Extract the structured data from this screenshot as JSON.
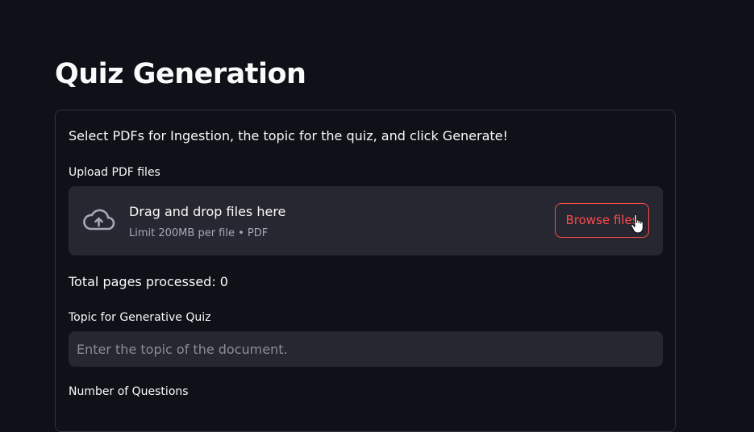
{
  "page": {
    "title": "Quiz Generation"
  },
  "form": {
    "intro": "Select PDFs for Ingestion, the topic for the quiz, and click Generate!",
    "upload": {
      "label": "Upload PDF files",
      "drop_title": "Drag and drop files here",
      "drop_subtitle": "Limit 200MB per file • PDF",
      "browse_label": "Browse files",
      "icon": "cloud-upload-icon"
    },
    "pages_processed": "Total pages processed: 0",
    "topic": {
      "label": "Topic for Generative Quiz",
      "value": "",
      "placeholder": "Enter the topic of the document."
    },
    "questions": {
      "label": "Number of Questions"
    }
  },
  "colors": {
    "background": "#0e1117",
    "surface": "#262730",
    "border": "#31333f",
    "accent": "#ff4b4b",
    "text": "#fafafa",
    "muted_text": "#a3a8b8"
  }
}
